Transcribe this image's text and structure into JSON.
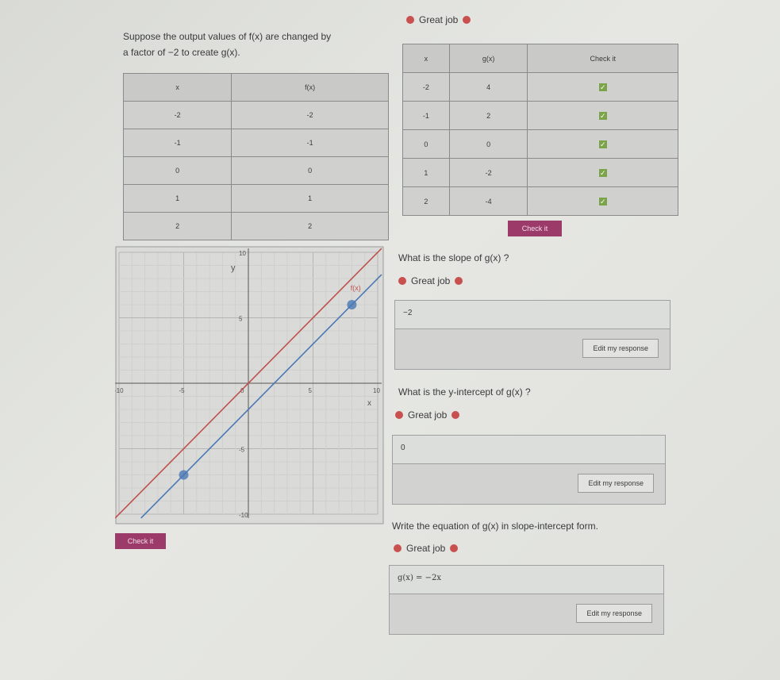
{
  "top_feedback": "Great job",
  "prompt": {
    "line1": "Suppose the output values of f(x) are changed by",
    "line2": "a factor of −2 to create g(x)."
  },
  "table_f": {
    "headers": [
      "x",
      "f(x)"
    ],
    "rows": [
      [
        "-2",
        "-2"
      ],
      [
        "-1",
        "-1"
      ],
      [
        "0",
        "0"
      ],
      [
        "1",
        "1"
      ],
      [
        "2",
        "2"
      ]
    ]
  },
  "table_g": {
    "headers": [
      "x",
      "g(x)",
      "Check it"
    ],
    "rows": [
      [
        "-2",
        "4"
      ],
      [
        "-1",
        "2"
      ],
      [
        "0",
        "0"
      ],
      [
        "1",
        "-2"
      ],
      [
        "2",
        "-4"
      ]
    ],
    "check_icon": "checkmark-icon"
  },
  "check_label": "Check it",
  "graph_check_label": "Check it",
  "chart_data": {
    "type": "line",
    "xlabel": "x",
    "ylabel": "y",
    "xlim": [
      -10,
      10
    ],
    "ylim": [
      -10,
      10
    ],
    "x_ticks": [
      "-10",
      "-5",
      "5",
      "10"
    ],
    "y_ticks": [
      "10",
      "5",
      "-5",
      "-10"
    ],
    "origin_label": "0",
    "grid": true,
    "series": [
      {
        "name": "f(x)",
        "slope": 1,
        "intercept": 0,
        "color": "#c0504d"
      },
      {
        "slope": 1,
        "intercept": -2,
        "color": "#4a78b5",
        "points": [
          [
            -5,
            -7
          ],
          [
            8,
            6
          ]
        ]
      }
    ]
  },
  "questions": [
    {
      "text": "What is the slope of g(x) ?",
      "feedback": "Great job",
      "answer": "−2",
      "edit_label": "Edit my response"
    },
    {
      "text": "What is the y-intercept of g(x) ?",
      "feedback": "Great job",
      "answer": "0",
      "edit_label": "Edit my response"
    },
    {
      "text": "Write the equation of g(x) in slope-intercept form.",
      "feedback": "Great job",
      "answer": "g(x) = −2x",
      "edit_label": "Edit my response"
    }
  ],
  "colors": {
    "feedback_dot": "#c8504f",
    "button": "#9c3b6a",
    "check": "#7aa34a"
  }
}
